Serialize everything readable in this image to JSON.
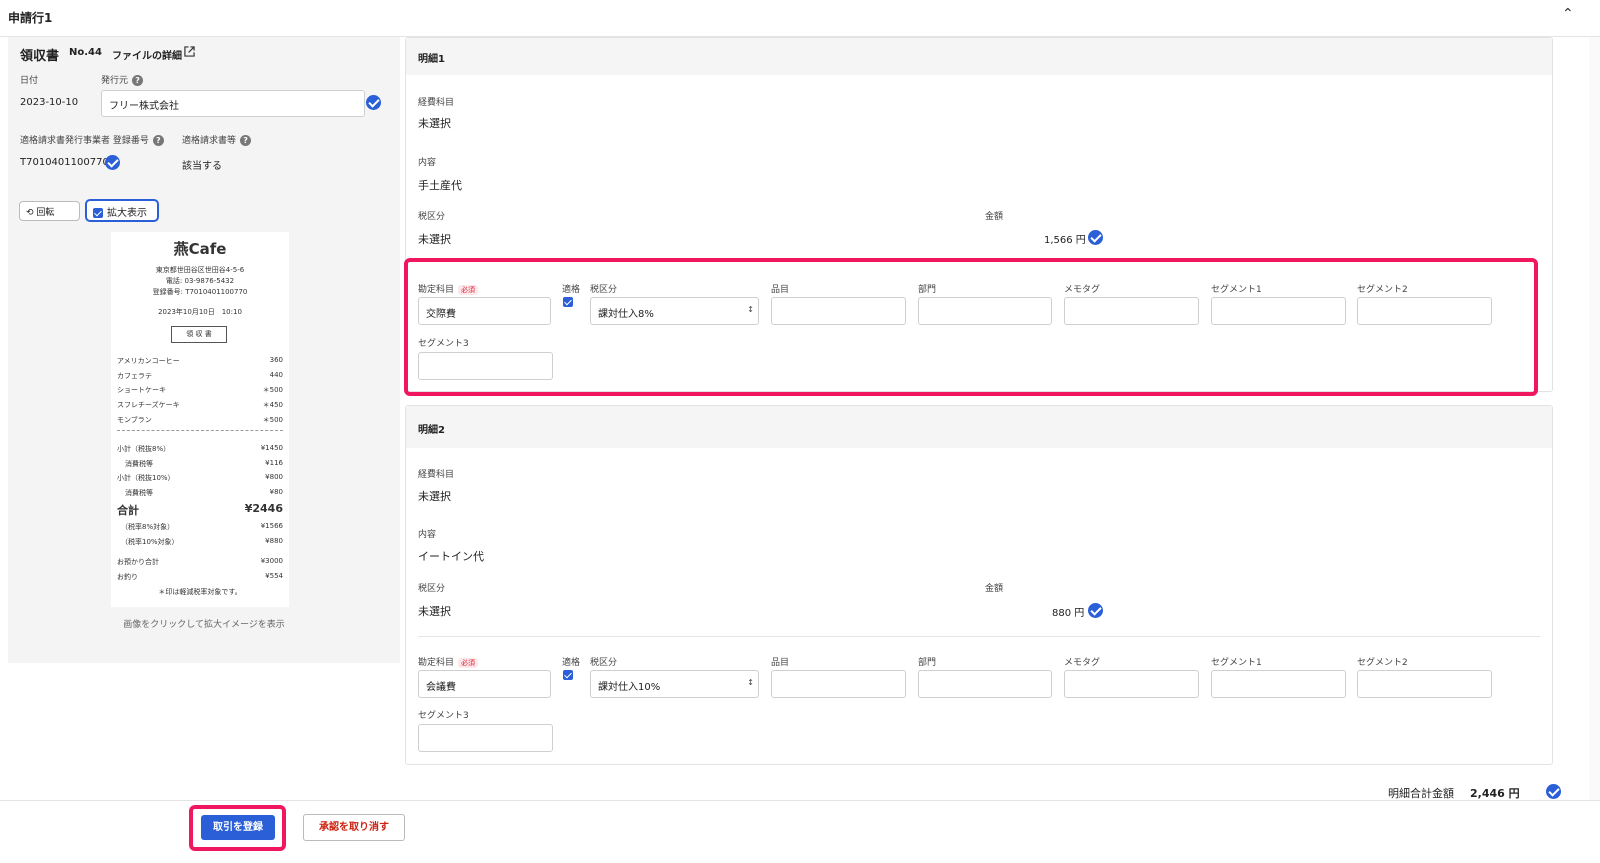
{
  "header": {
    "title": "申請行1",
    "collapse_icon": "chevron-up-icon"
  },
  "receipt_info": {
    "doc_type": "領収書",
    "doc_no": "No.44",
    "file_link": "ファイルの詳細",
    "date_label": "日付",
    "date_value": "2023-10-10",
    "issuer_label": "発行元",
    "issuer_value": "フリー株式会社",
    "reg_no_label": "適格請求書発行事業者 登録番号",
    "reg_no_value": "T7010401100770",
    "qualified_label": "適格請求書等",
    "qualified_value": "該当する",
    "rotate_label": "回転",
    "zoom_label": "拡大表示",
    "caption": "画像をクリックして拡大イメージを表示"
  },
  "receipt_image": {
    "store": "燕Cafe",
    "address": "東京都世田谷区世田谷4-5-6",
    "phone": "電話: 03-9876-5432",
    "reg": "登録番号: T7010401100770",
    "datetime": "2023年10月10日　10:10",
    "box": "領 収 書",
    "items": [
      {
        "name": "アメリカンコーヒー",
        "price": "360"
      },
      {
        "name": "カフェラテ",
        "price": "440"
      },
      {
        "name": "ショートケーキ",
        "price": "＊500"
      },
      {
        "name": "スフレチーズケーキ",
        "price": "＊450"
      },
      {
        "name": "モンブラン",
        "price": "＊500"
      }
    ],
    "sub1_label": "小計（税抜8%）",
    "sub1_value": "¥1450",
    "tax1_label": "消費税等",
    "tax1_value": "¥116",
    "sub2_label": "小計（税抜10%）",
    "sub2_value": "¥800",
    "tax2_label": "消費税等",
    "tax2_value": "¥80",
    "total_label": "合計",
    "total_value": "¥2446",
    "r8_label": "（税率8%対象）",
    "r8_value": "¥1566",
    "r10_label": "（税率10%対象）",
    "r10_value": "¥880",
    "paid_label": "お預かり合計",
    "paid_value": "¥3000",
    "change_label": "お釣り",
    "change_value": "¥554",
    "note": "＊印は軽減税率対象です。"
  },
  "details": [
    {
      "title": "明細1",
      "expense_label": "経費科目",
      "expense_value": "未選択",
      "content_label": "内容",
      "content_value": "手土産代",
      "tax_label": "税区分",
      "tax_value": "未選択",
      "amount_label": "金額",
      "amount_value": "1,566 円",
      "account_label": "勘定科目",
      "required": "必須",
      "account_value": "交際費",
      "qualified_label": "適格",
      "taxcat_label": "税区分",
      "taxcat_value": "課対仕入8%",
      "item_label": "品目",
      "dept_label": "部門",
      "memo_label": "メモタグ",
      "seg1_label": "セグメント1",
      "seg2_label": "セグメント2",
      "seg3_label": "セグメント3"
    },
    {
      "title": "明細2",
      "expense_label": "経費科目",
      "expense_value": "未選択",
      "content_label": "内容",
      "content_value": "イートイン代",
      "tax_label": "税区分",
      "tax_value": "未選択",
      "amount_label": "金額",
      "amount_value": "880 円",
      "account_label": "勘定科目",
      "required": "必須",
      "account_value": "会議費",
      "qualified_label": "適格",
      "taxcat_label": "税区分",
      "taxcat_value": "課対仕入10%",
      "item_label": "品目",
      "dept_label": "部門",
      "memo_label": "メモタグ",
      "seg1_label": "セグメント1",
      "seg2_label": "セグメント2",
      "seg3_label": "セグメント3"
    }
  ],
  "summary": {
    "label": "明細合計金額",
    "value": "2,446 円"
  },
  "footer": {
    "register_label": "取引を登録",
    "cancel_label": "承認を取り消す"
  },
  "colors": {
    "accent": "#2a5fd8",
    "highlight": "#f0175e",
    "danger": "#c21"
  }
}
